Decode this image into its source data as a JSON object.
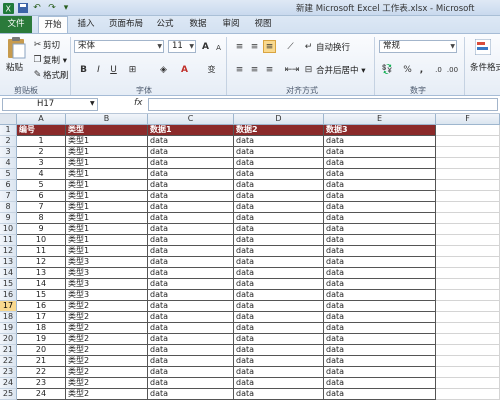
{
  "window": {
    "title": "新建 Microsoft Excel 工作表.xlsx - Microsoft"
  },
  "quick_access": [
    "excel-logo-icon",
    "save-icon",
    "undo-icon",
    "redo-icon",
    "customize-icon"
  ],
  "tabs": [
    {
      "label": "文件",
      "active": false,
      "file": true
    },
    {
      "label": "开始",
      "active": true
    },
    {
      "label": "插入",
      "active": false
    },
    {
      "label": "页面布局",
      "active": false
    },
    {
      "label": "公式",
      "active": false
    },
    {
      "label": "数据",
      "active": false
    },
    {
      "label": "审阅",
      "active": false
    },
    {
      "label": "视图",
      "active": false
    }
  ],
  "ribbon": {
    "clipboard": {
      "paste": "粘贴",
      "cut": "剪切",
      "copy": "复制 ▾",
      "format_painter": "格式刷",
      "label": "剪贴板"
    },
    "font": {
      "name": "宋体",
      "size": "11",
      "label": "字体",
      "bold": "B",
      "italic": "I",
      "underline": "U",
      "grow": "A",
      "shrink": "A",
      "wen": "变"
    },
    "alignment": {
      "wrap": "自动换行",
      "merge": "合并后居中 ▾",
      "label": "对齐方式"
    },
    "number": {
      "format": "常规",
      "percent": "%",
      "comma": ",",
      "label": "数字"
    },
    "styles": {
      "conditional": "条件格式"
    }
  },
  "formula_bar": {
    "name_box": "H17",
    "fx": "fx",
    "value": ""
  },
  "sheet": {
    "columns": [
      "A",
      "B",
      "C",
      "D",
      "E",
      "F"
    ],
    "header": [
      "编号",
      "类型",
      "数据1",
      "数据2",
      "数据3"
    ],
    "selected_row": 17,
    "rows": [
      [
        "1",
        "类型1",
        "data",
        "data",
        "data"
      ],
      [
        "2",
        "类型1",
        "data",
        "data",
        "data"
      ],
      [
        "3",
        "类型1",
        "data",
        "data",
        "data"
      ],
      [
        "4",
        "类型1",
        "data",
        "data",
        "data"
      ],
      [
        "5",
        "类型1",
        "data",
        "data",
        "data"
      ],
      [
        "6",
        "类型1",
        "data",
        "data",
        "data"
      ],
      [
        "7",
        "类型1",
        "data",
        "data",
        "data"
      ],
      [
        "8",
        "类型1",
        "data",
        "data",
        "data"
      ],
      [
        "9",
        "类型1",
        "data",
        "data",
        "data"
      ],
      [
        "10",
        "类型1",
        "data",
        "data",
        "data"
      ],
      [
        "11",
        "类型1",
        "data",
        "data",
        "data"
      ],
      [
        "12",
        "类型3",
        "data",
        "data",
        "data"
      ],
      [
        "13",
        "类型3",
        "data",
        "data",
        "data"
      ],
      [
        "14",
        "类型3",
        "data",
        "data",
        "data"
      ],
      [
        "15",
        "类型3",
        "data",
        "data",
        "data"
      ],
      [
        "16",
        "类型2",
        "data",
        "data",
        "data"
      ],
      [
        "17",
        "类型2",
        "data",
        "data",
        "data"
      ],
      [
        "18",
        "类型2",
        "data",
        "data",
        "data"
      ],
      [
        "19",
        "类型2",
        "data",
        "data",
        "data"
      ],
      [
        "20",
        "类型2",
        "data",
        "data",
        "data"
      ],
      [
        "21",
        "类型2",
        "data",
        "data",
        "data"
      ],
      [
        "22",
        "类型2",
        "data",
        "data",
        "data"
      ],
      [
        "23",
        "类型2",
        "data",
        "data",
        "data"
      ],
      [
        "24",
        "类型2",
        "data",
        "data",
        "data"
      ]
    ]
  },
  "colors": {
    "header_fill": "#8b2a2a",
    "file_tab": "#2a7a3a",
    "selected_row_header": "#f9d98e"
  }
}
